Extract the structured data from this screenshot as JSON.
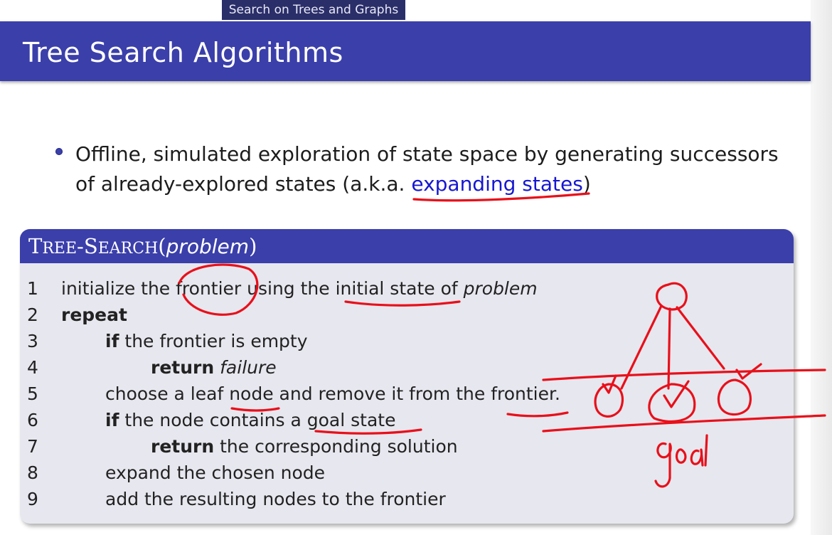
{
  "header": {
    "section_tab": "Search on Trees and Graphs",
    "title": "Tree Search Algorithms"
  },
  "bullet": {
    "text_part1": "Offline, simulated exploration of state space by generating successors of already-explored states (a.k.a. ",
    "link_text": "expanding states",
    "text_part2": ")"
  },
  "algorithm": {
    "name_T": "T",
    "name_ree": "REE",
    "name_dash": "-",
    "name_S": "S",
    "name_earch": "EARCH",
    "open_paren": "(",
    "argument": "problem",
    "close_paren": ")",
    "lines": [
      {
        "num": "1",
        "parts": [
          "initialize the frontier using the initial state of ",
          "problem"
        ]
      },
      {
        "num": "2",
        "parts": [
          "repeat"
        ]
      },
      {
        "num": "3",
        "parts": [
          "if",
          " the frontier is empty"
        ]
      },
      {
        "num": "4",
        "parts": [
          "return",
          " ",
          "failure"
        ]
      },
      {
        "num": "5",
        "parts": [
          "choose a leaf node and remove it from the frontier."
        ]
      },
      {
        "num": "6",
        "parts": [
          "if",
          " the node contains a goal state"
        ]
      },
      {
        "num": "7",
        "parts": [
          "return",
          " the corresponding solution"
        ]
      },
      {
        "num": "8",
        "parts": [
          "expand the chosen node"
        ]
      },
      {
        "num": "9",
        "parts": [
          "add the resulting nodes to the frontier"
        ]
      }
    ]
  },
  "annotation": {
    "handwritten_label": "goal",
    "ink_color": "#e8101a"
  },
  "colors": {
    "title_bar": "#3b3faa",
    "nav_tab": "#2a2f6a",
    "block_body": "#e7e7ef",
    "link": "#1717cf"
  }
}
